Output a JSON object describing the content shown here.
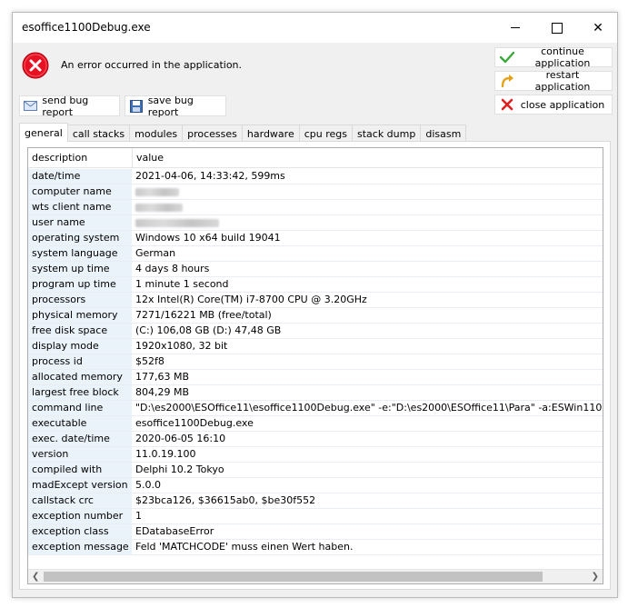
{
  "window": {
    "title": "esoffice1100Debug.exe",
    "minimize_glyph": "",
    "close_glyph": "✕"
  },
  "error": {
    "message": "An error occurred in the application.",
    "icon": "error-icon"
  },
  "actions": {
    "continue_label": "continue application",
    "restart_label": "restart application",
    "close_label": "close application"
  },
  "report": {
    "send_label": "send bug report",
    "save_label": "save bug report"
  },
  "tabs": [
    "general",
    "call stacks",
    "modules",
    "processes",
    "hardware",
    "cpu regs",
    "stack dump",
    "disasm"
  ],
  "table": {
    "header": {
      "description": "description",
      "value": "value"
    },
    "rows": [
      {
        "k": "date/time",
        "v": "2021-04-06, 14:33:42, 599ms"
      },
      {
        "k": "computer name",
        "v": ""
      },
      {
        "k": "wts client name",
        "v": ""
      },
      {
        "k": "user name",
        "v": ""
      },
      {
        "k": "operating system",
        "v": "Windows 10 x64 build 19041"
      },
      {
        "k": "system language",
        "v": "German"
      },
      {
        "k": "system up time",
        "v": "4 days 8 hours"
      },
      {
        "k": "program up time",
        "v": "1 minute 1 second"
      },
      {
        "k": "processors",
        "v": "12x Intel(R) Core(TM) i7-8700 CPU @ 3.20GHz"
      },
      {
        "k": "physical memory",
        "v": "7271/16221 MB (free/total)"
      },
      {
        "k": "free disk space",
        "v": "(C:) 106,08 GB (D:) 47,48 GB"
      },
      {
        "k": "display mode",
        "v": "1920x1080, 32 bit"
      },
      {
        "k": "process id",
        "v": "$52f8"
      },
      {
        "k": "allocated memory",
        "v": "177,63 MB"
      },
      {
        "k": "largest free block",
        "v": "804,29 MB"
      },
      {
        "k": "command line",
        "v": "\"D:\\es2000\\ESOffice11\\esoffice1100Debug.exe\"  -e:\"D:\\es2000\\ESOffice11\\Para\" -a:ESWin1100 -n:ESNLS -"
      },
      {
        "k": "executable",
        "v": "esoffice1100Debug.exe"
      },
      {
        "k": "exec. date/time",
        "v": "2020-06-05 16:10"
      },
      {
        "k": "version",
        "v": "11.0.19.100"
      },
      {
        "k": "compiled with",
        "v": "Delphi 10.2 Tokyo"
      },
      {
        "k": "madExcept version",
        "v": "5.0.0"
      },
      {
        "k": "callstack crc",
        "v": "$23bca126, $36615ab0, $be30f552"
      },
      {
        "k": "exception number",
        "v": "1"
      },
      {
        "k": "exception class",
        "v": "EDatabaseError"
      },
      {
        "k": "exception message",
        "v": "Feld 'MATCHCODE' muss einen Wert haben."
      }
    ]
  },
  "colors": {
    "key_column_bg": "#eaf2fa",
    "error_red": "#e81123"
  }
}
